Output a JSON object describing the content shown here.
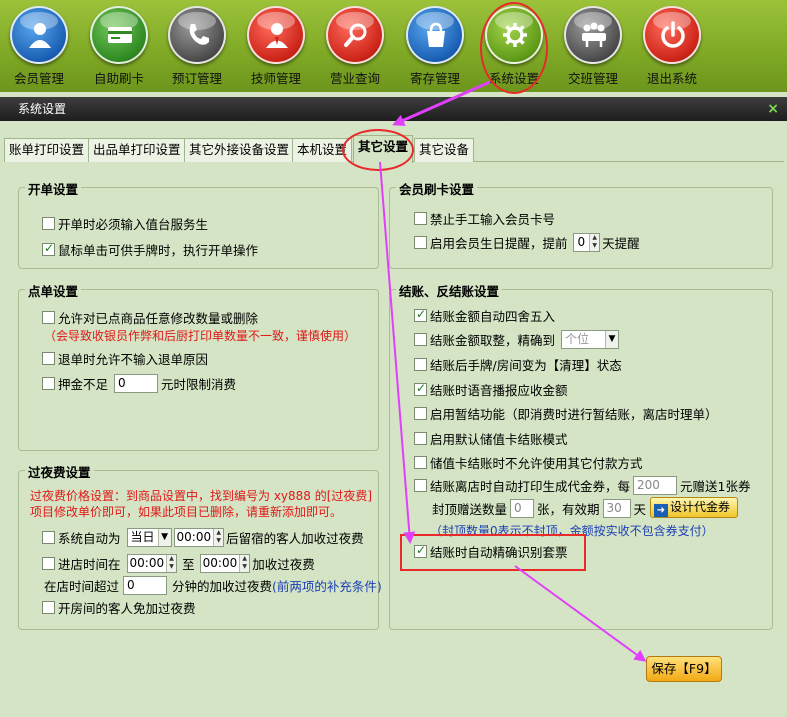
{
  "toolbar": {
    "items": [
      {
        "label": "会员管理",
        "icon": "member-icon"
      },
      {
        "label": "自助刷卡",
        "icon": "card-icon"
      },
      {
        "label": "预订管理",
        "icon": "phone-icon"
      },
      {
        "label": "技师管理",
        "icon": "technician-icon"
      },
      {
        "label": "营业查询",
        "icon": "search-icon"
      },
      {
        "label": "寄存管理",
        "icon": "bag-icon"
      },
      {
        "label": "系统设置",
        "icon": "gear-icon"
      },
      {
        "label": "交班管理",
        "icon": "shift-icon"
      },
      {
        "label": "退出系统",
        "icon": "power-icon"
      }
    ]
  },
  "dialog": {
    "title": "系统设置",
    "close": "×",
    "tabs": [
      "账单打印设置",
      "出品单打印设置",
      "其它外接设备设置",
      "本机设置",
      "其它设置",
      "其它设备"
    ]
  },
  "open_bill": {
    "title": "开单设置",
    "opt1": "开单时必须输入值台服务生",
    "opt2": "鼠标单击可供手牌时，执行开单操作"
  },
  "order": {
    "title": "点单设置",
    "opt1": "允许对已点商品任意修改数量或删除",
    "note": "（会导致收银员作弊和后厨打印单数量不一致，谨慎使用）",
    "opt2": "退单时允许不输入退单原因",
    "opt3": "押金不足",
    "deposit_value": "0",
    "opt3_suffix": "元时限制消费"
  },
  "overnight": {
    "title": "过夜费设置",
    "note1": "过夜费价格设置：到商品设置中，找到编号为 xy888 的[过夜费]",
    "note2": "项目修改单价即可，如果此项目已删除，请重新添加即可。",
    "auto_label": "系统自动为",
    "auto_day": "当日",
    "auto_time": "00:00",
    "auto_suffix": "后留宿的客人加收过夜费",
    "enter_label": "进店时间在",
    "enter_from": "00:00",
    "enter_to_label": "至",
    "enter_to": "00:00",
    "enter_suffix": "加收过夜费",
    "stay_label": "在店时间超过",
    "stay_value": "0",
    "stay_suffix": "分钟的加收过夜费",
    "stay_note": "(前两项的补充条件)",
    "free_label": "开房间的客人免加过夜费"
  },
  "member_card": {
    "title": "会员刷卡设置",
    "opt1": "禁止手工输入会员卡号",
    "opt2": "启用会员生日提醒，提前",
    "days_value": "0",
    "opt2_suffix": "天提醒"
  },
  "checkout": {
    "title": "结账、反结账设置",
    "opt1": "结账金额自动四舍五入",
    "opt2": "结账金额取整，精确到",
    "precision": "个位",
    "opt3": "结账后手牌/房间变为【清理】状态",
    "opt4": "结账时语音播报应收金额",
    "opt5": "启用暂结功能（即消费时进行暂结账，离店时理单）",
    "opt6": "启用默认储值卡结账模式",
    "opt7": "储值卡结账时不允许使用其它付款方式",
    "opt8": "结账离店时自动打印生成代金券，每",
    "voucher_amount": "200",
    "opt8_suffix": "元赠送1张券",
    "cap_label": "封顶赠送数量",
    "cap_value": "0",
    "cap_unit": "张，有效期",
    "valid_value": "30",
    "valid_unit": "天",
    "design_btn": "设计代金券",
    "cap_note": "（封顶数量0表示不封顶，金额按实收不包含券支付）",
    "opt9": "结账时自动精确识别套票"
  },
  "save_button": "保存【F9】",
  "colors": {
    "accent": "#e82a2a",
    "arrow": "#e040fb",
    "toolbar": "#8ab62e"
  }
}
